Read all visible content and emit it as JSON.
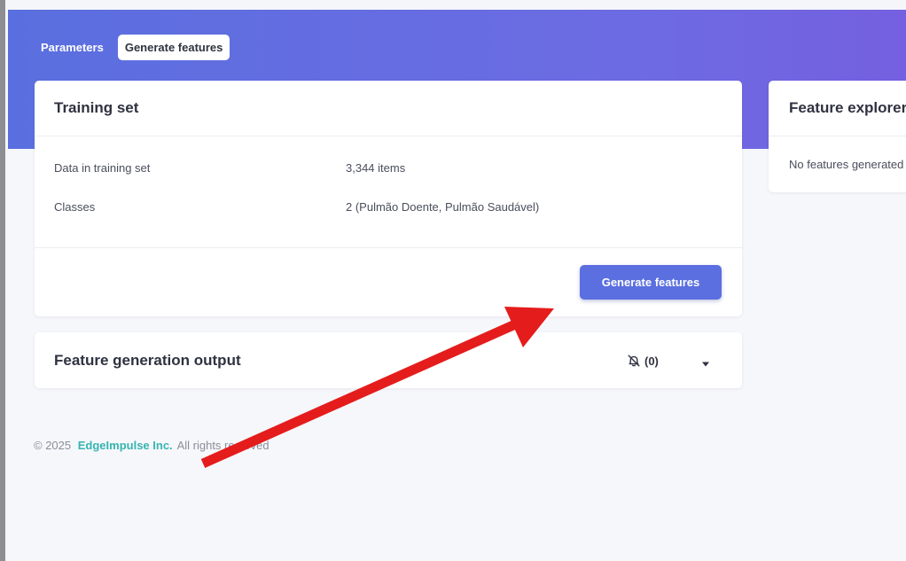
{
  "tabs": [
    {
      "label": "Parameters",
      "active": false
    },
    {
      "label": "Generate features",
      "active": true
    }
  ],
  "training_set": {
    "title": "Training set",
    "rows": [
      {
        "label": "Data in training set",
        "value": "3,344 items"
      },
      {
        "label": "Classes",
        "value": "2 (Pulmão Doente, Pulmão Saudável)"
      }
    ],
    "button_label": "Generate features"
  },
  "output": {
    "title": "Feature generation output",
    "notification_count": "(0)",
    "notification_icon": "bell-off-icon",
    "expand_icon": "caret-down-icon"
  },
  "explorer": {
    "title": "Feature explorer",
    "empty_text": "No features generated"
  },
  "footer": {
    "copyright": "© 2025",
    "brand": "EdgeImpulse Inc.",
    "rights": "All rights reserved"
  },
  "colors": {
    "header_gradient_start": "#5a6fdf",
    "header_gradient_end": "#7460e0",
    "primary_button": "#5b6fe0",
    "brand_link": "#36b5b0",
    "annotation_arrow": "#e51c1c"
  }
}
